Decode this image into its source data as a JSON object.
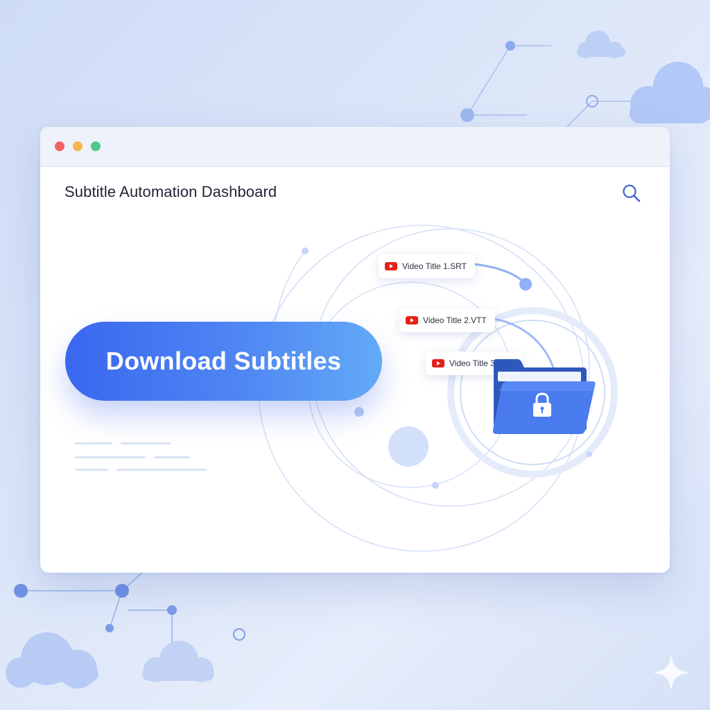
{
  "window": {
    "traffic_lights": [
      "close",
      "minimize",
      "maximize"
    ]
  },
  "header": {
    "title": "Subtitle Automation Dashboard",
    "search_icon": "search-icon"
  },
  "main": {
    "download_button_label": "Download Subtitles",
    "files": [
      {
        "label": "Video Title 1.SRT",
        "icon": "youtube-icon"
      },
      {
        "label": "Video Title 2.VTT",
        "icon": "youtube-icon"
      },
      {
        "label": "Video Title 3.TXT",
        "icon": "youtube-icon"
      }
    ],
    "folder_icon": "locked-folder-icon"
  },
  "colors": {
    "accent": "#3a67ef",
    "accent_light": "#63aaf7",
    "youtube_red": "#e62117",
    "folder_blue": "#4a7cf0"
  }
}
